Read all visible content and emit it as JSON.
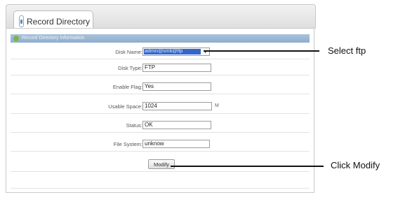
{
  "tab": {
    "label": "Record Directory"
  },
  "section": {
    "title": "Record Directory Information"
  },
  "form": {
    "disk_name": {
      "label": "Disk Name:",
      "value": "admin@smb@ftp"
    },
    "disk_type": {
      "label": "Disk Type:",
      "value": "FTP"
    },
    "enable_flag": {
      "label": "Enable Flag:",
      "value": "Yes"
    },
    "usable_space": {
      "label": "Usable Space:",
      "value": "1024",
      "unit": "M"
    },
    "status": {
      "label": "Status:",
      "value": "OK"
    },
    "file_system": {
      "label": "File System:",
      "value": "unknow"
    },
    "modify_label": "Modify"
  },
  "annotations": {
    "select_ftp": "Select ftp",
    "click_modify": "Click Modify"
  },
  "colors": {
    "section_bar": "#99b6d4",
    "selection_highlight": "#3366cc"
  },
  "icons": {
    "tab": "record-directory-icon",
    "section": "info-icon",
    "dropdown": "chevron-down-icon"
  }
}
